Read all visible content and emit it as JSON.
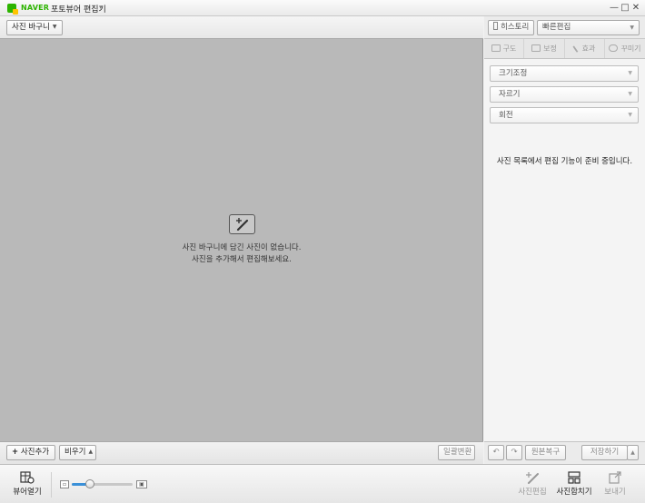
{
  "titlebar": {
    "brand": "NAVER",
    "title": "포토뷰어 편집기",
    "title_caret": "▾",
    "minimize": "—",
    "maximize": "□",
    "close": "✕"
  },
  "left": {
    "basket_dropdown": "사진 바구니",
    "empty_line1": "사진 바구니에 담긴 사진이 없습니다.",
    "empty_line2": "사진을 추가해서 편집해보세요.",
    "add_photo": "사진추가",
    "clear": "비우기",
    "batch_convert": "일괄변환"
  },
  "right": {
    "history": "히스토리",
    "quick_edit": "빠른편집",
    "tabs": [
      "구도",
      "보정",
      "효과",
      "꾸미기"
    ],
    "sections": [
      "크기조정",
      "자르기",
      "회전"
    ],
    "message": "사진 목록에서 편집 기능이 준비 중입니다.",
    "undo": "↶",
    "redo": "↷",
    "restore": "원본복구",
    "save": "저장하기"
  },
  "footer": {
    "open_viewer": "뷰어열기",
    "edit_photo": "사진편집",
    "merge_photo": "사진합치기",
    "send": "보내기",
    "zoom_level": 0.3
  },
  "colors": {
    "brand": "#2db400",
    "canvas": "#b9b9b9",
    "accent": "#3a90d8"
  }
}
